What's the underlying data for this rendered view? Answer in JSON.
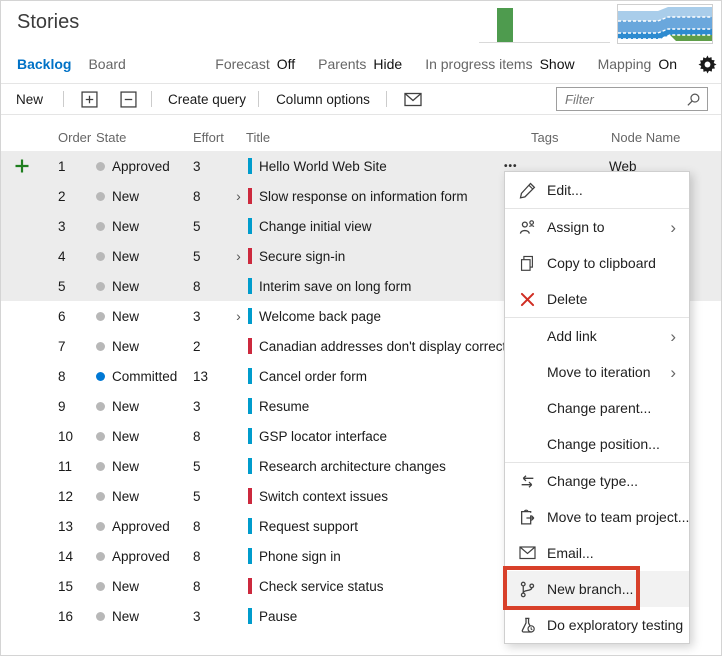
{
  "app": {
    "title": "Stories"
  },
  "tabs": {
    "backlog": "Backlog",
    "board": "Board"
  },
  "view_controls": [
    {
      "label": "Forecast",
      "value": "Off"
    },
    {
      "label": "Parents",
      "value": "Hide"
    },
    {
      "label": "In progress items",
      "value": "Show"
    },
    {
      "label": "Mapping",
      "value": "On"
    }
  ],
  "toolbar": {
    "new_label": "New",
    "create_query_label": "Create query",
    "column_options_label": "Column options"
  },
  "filter": {
    "placeholder": "Filter"
  },
  "table": {
    "columns": [
      "Order",
      "State",
      "Effort",
      "Title",
      "Tags",
      "Node Name"
    ],
    "rows": [
      {
        "order": 1,
        "state": "Approved",
        "effort": 3,
        "type": "story",
        "title": "Hello World Web Site",
        "expandable": false,
        "selected": true,
        "node_name": "Web",
        "menu_trigger": true,
        "add_button": true
      },
      {
        "order": 2,
        "state": "New",
        "effort": 8,
        "type": "bug",
        "title": "Slow response on information form",
        "expandable": true,
        "selected": true
      },
      {
        "order": 3,
        "state": "New",
        "effort": 5,
        "type": "story",
        "title": "Change initial view",
        "expandable": false,
        "selected": true
      },
      {
        "order": 4,
        "state": "New",
        "effort": 5,
        "type": "bug",
        "title": "Secure sign-in",
        "expandable": true,
        "selected": true
      },
      {
        "order": 5,
        "state": "New",
        "effort": 8,
        "type": "story",
        "title": "Interim save on long form",
        "expandable": false,
        "selected": true
      },
      {
        "order": 6,
        "state": "New",
        "effort": 3,
        "type": "story",
        "title": "Welcome back page",
        "expandable": true,
        "selected": false
      },
      {
        "order": 7,
        "state": "New",
        "effort": 2,
        "type": "bug",
        "title": "Canadian addresses don't display correctly",
        "expandable": false,
        "selected": false
      },
      {
        "order": 8,
        "state": "Committed",
        "effort": 13,
        "type": "story",
        "title": "Cancel order form",
        "expandable": false,
        "selected": false
      },
      {
        "order": 9,
        "state": "New",
        "effort": 3,
        "type": "story",
        "title": "Resume",
        "expandable": false,
        "selected": false
      },
      {
        "order": 10,
        "state": "New",
        "effort": 8,
        "type": "story",
        "title": "GSP locator interface",
        "expandable": false,
        "selected": false
      },
      {
        "order": 11,
        "state": "New",
        "effort": 5,
        "type": "story",
        "title": "Research architecture changes",
        "expandable": false,
        "selected": false
      },
      {
        "order": 12,
        "state": "New",
        "effort": 5,
        "type": "bug",
        "title": "Switch context issues",
        "expandable": false,
        "selected": false
      },
      {
        "order": 13,
        "state": "Approved",
        "effort": 8,
        "type": "story",
        "title": "Request support",
        "expandable": false,
        "selected": false
      },
      {
        "order": 14,
        "state": "Approved",
        "effort": 8,
        "type": "story",
        "title": "Phone sign in",
        "expandable": false,
        "selected": false
      },
      {
        "order": 15,
        "state": "New",
        "effort": 8,
        "type": "bug",
        "title": "Check service status",
        "expandable": false,
        "selected": false
      },
      {
        "order": 16,
        "state": "New",
        "effort": 3,
        "type": "story",
        "title": "Pause",
        "expandable": false,
        "selected": false
      }
    ]
  },
  "context_menu": {
    "items": [
      {
        "label": "Edit...",
        "icon": "pencil",
        "submenu": false,
        "divider_after": true,
        "highlighted": false
      },
      {
        "label": "Assign to",
        "icon": "people",
        "submenu": true,
        "divider_after": false,
        "highlighted": false
      },
      {
        "label": "Copy to clipboard",
        "icon": "copy",
        "submenu": false,
        "divider_after": false,
        "highlighted": false
      },
      {
        "label": "Delete",
        "icon": "delete",
        "submenu": false,
        "divider_after": true,
        "highlighted": false
      },
      {
        "label": "Add link",
        "icon": null,
        "submenu": true,
        "divider_after": false,
        "highlighted": false
      },
      {
        "label": "Move to iteration",
        "icon": null,
        "submenu": true,
        "divider_after": false,
        "highlighted": false
      },
      {
        "label": "Change parent...",
        "icon": null,
        "submenu": false,
        "divider_after": false,
        "highlighted": false
      },
      {
        "label": "Change position...",
        "icon": null,
        "submenu": false,
        "divider_after": true,
        "highlighted": false
      },
      {
        "label": "Change type...",
        "icon": "change-type",
        "submenu": false,
        "divider_after": false,
        "highlighted": false
      },
      {
        "label": "Move to team project...",
        "icon": "move-project",
        "submenu": false,
        "divider_after": false,
        "highlighted": false
      },
      {
        "label": "Email...",
        "icon": "mail",
        "submenu": false,
        "divider_after": false,
        "highlighted": false
      },
      {
        "label": "New branch...",
        "icon": "branch",
        "submenu": false,
        "divider_after": false,
        "highlighted": true
      },
      {
        "label": "Do exploratory testing",
        "icon": "beaker",
        "submenu": false,
        "divider_after": false,
        "highlighted": false
      }
    ]
  },
  "charts": {
    "velocity": {
      "type": "bar",
      "description": "velocity chart thumbnail with one green bar",
      "bar_color": "#4e9b4e"
    },
    "cumulative_flow": {
      "type": "area",
      "description": "cumulative flow diagram thumbnail",
      "layer_colors": [
        "#a9cdea",
        "#6aa7dc",
        "#2e8bd0",
        "#5f9e49"
      ]
    }
  },
  "colors": {
    "accent_blue": "#0072c6",
    "selection_bg": "#ececec",
    "hover_bg": "#f2f2f2",
    "annotation_red": "#d8402a",
    "story_bar": "#009ccc",
    "bug_bar": "#cc293d",
    "state_default_dot": "#b8b8b8",
    "state_committed_dot": "#0078d4",
    "delete_red": "#d02e23",
    "add_green": "#1e7e1e",
    "velocity_green": "#4e9b4e",
    "cfd_layers": [
      "#a9cdea",
      "#6aa7dc",
      "#2e8bd0",
      "#5f9e49"
    ]
  }
}
